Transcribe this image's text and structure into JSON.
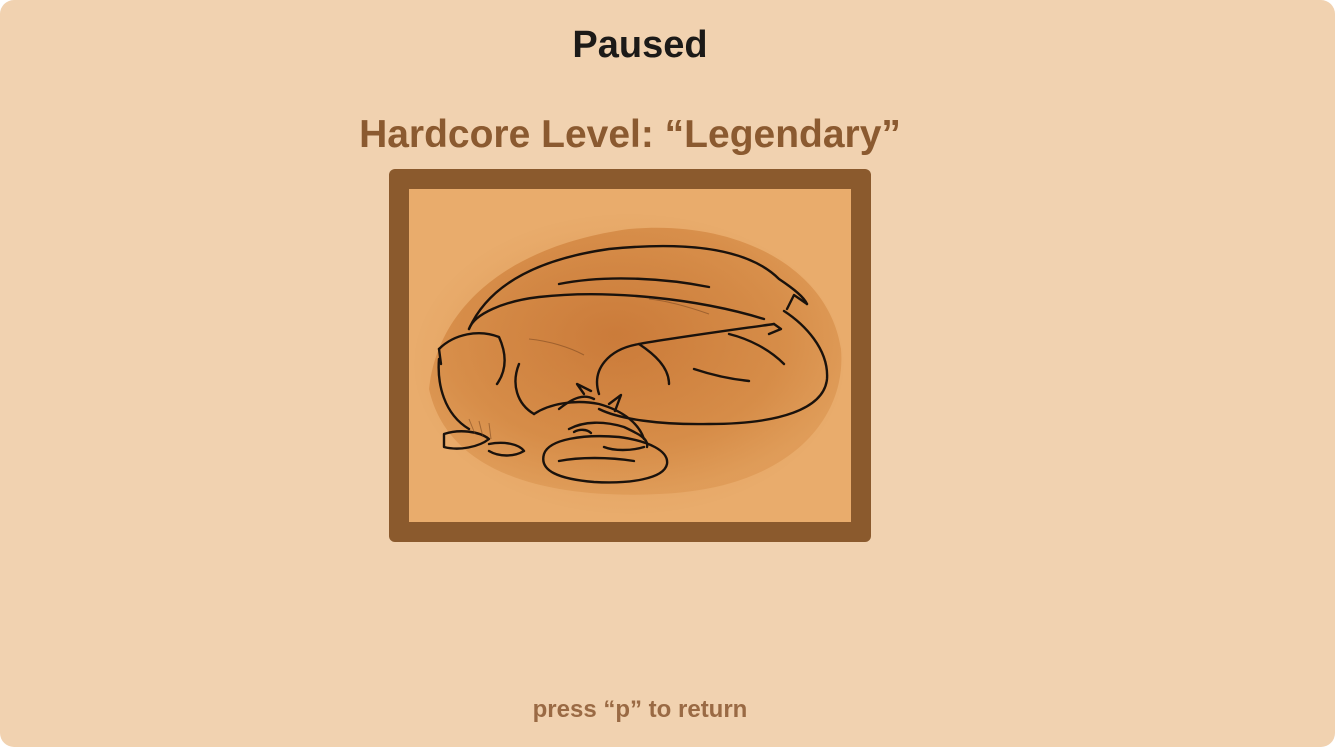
{
  "pause_screen": {
    "title": "Paused",
    "level_heading": "Hardcore Level: “Legendary”",
    "illustration_icon": "sleeping-dragon-icon",
    "return_hint": "press “p” to return"
  },
  "colors": {
    "panel_background": "#f1d2b0",
    "title_text": "#1c1a18",
    "level_text": "#8b5a30",
    "frame": "#8b5a2d",
    "canvas": "#e9ac6c",
    "hint_text": "#9a6a44"
  }
}
